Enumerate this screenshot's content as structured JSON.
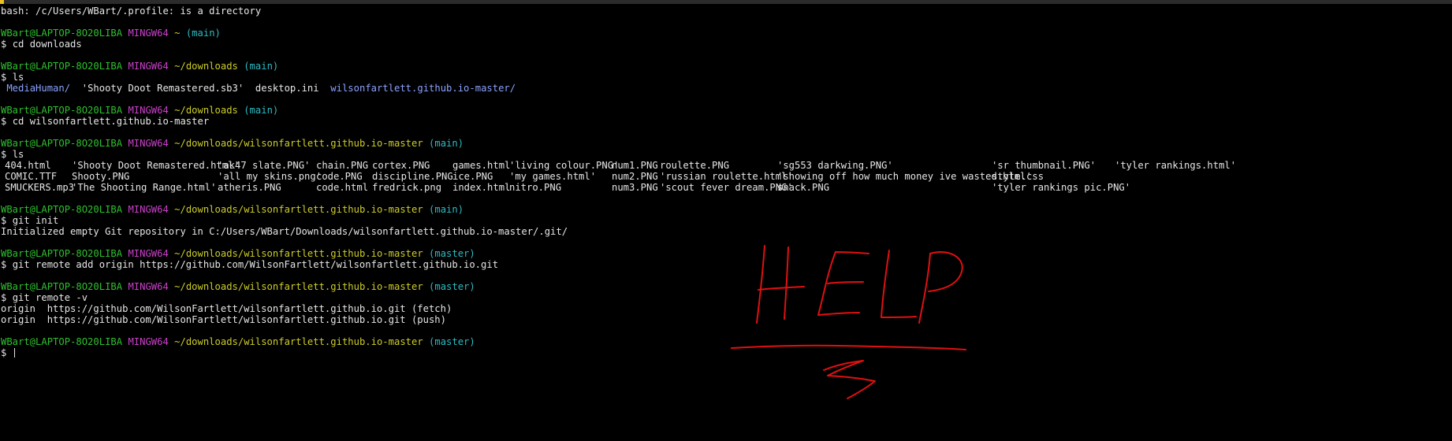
{
  "terminal": {
    "profile_error": "bash: /c/Users/WBart/.profile: is a directory",
    "prompt": {
      "user_host": "WBart@LAPTOP-8O20LIBA",
      "system": "MINGW64",
      "symbol": "$"
    },
    "blocks": [
      {
        "path": "~",
        "branch": "(main)",
        "command": "cd downloads",
        "output": []
      },
      {
        "path": "~/downloads",
        "branch": "(main)",
        "command": "ls"
      },
      {
        "path": "~/downloads",
        "branch": "(main)",
        "command": "cd wilsonfartlett.github.io-master",
        "output": []
      },
      {
        "path": "~/downloads/wilsonfartlett.github.io-master",
        "branch": "(main)",
        "command": "ls"
      },
      {
        "path": "~/downloads/wilsonfartlett.github.io-master",
        "branch": "(main)",
        "command": "git init",
        "output": [
          "Initialized empty Git repository in C:/Users/WBart/Downloads/wilsonfartlett.github.io-master/.git/"
        ]
      },
      {
        "path": "~/downloads/wilsonfartlett.github.io-master",
        "branch": "(master)",
        "command": "git remote add origin https://github.com/WilsonFartlett/wilsonfartlett.github.io.git",
        "output": []
      },
      {
        "path": "~/downloads/wilsonfartlett.github.io-master",
        "branch": "(master)",
        "command": "git remote -v",
        "output": [
          "origin  https://github.com/WilsonFartlett/wilsonfartlett.github.io.git (fetch)",
          "origin  https://github.com/WilsonFartlett/wilsonfartlett.github.io.git (push)"
        ]
      },
      {
        "path": "~/downloads/wilsonfartlett.github.io-master",
        "branch": "(master)",
        "command": "",
        "output": []
      }
    ],
    "ls_downloads": [
      {
        "name": "MediaHuman/",
        "dir": true
      },
      {
        "name": "'Shooty Doot Remastered.sb3'",
        "dir": false
      },
      {
        "name": "desktop.ini",
        "dir": false
      },
      {
        "name": "wilsonfartlett.github.io-master/",
        "dir": true
      }
    ],
    "ls_repo": [
      [
        "404.html",
        "'Shooty Doot Remastered.html'",
        "'ak47 slate.PNG'",
        "chain.PNG",
        "cortex.PNG",
        "games.html",
        "'living colour.PNG'",
        "num1.PNG",
        "roulette.PNG",
        "'sg553 darkwing.PNG'",
        "'sr thumbnail.PNG'",
        "'tyler rankings.html'"
      ],
      [
        "COMIC.TTF",
        "Shooty.PNG",
        "'all my skins.png'",
        "code.PNG",
        "discipline.PNG",
        "ice.PNG",
        "'my games.html'",
        "num2.PNG",
        "'russian roulette.html'",
        "'showing off how much money ive wasted.html'",
        "style.css",
        ""
      ],
      [
        "SMUCKERS.mp3",
        "'The Shooting Range.html'",
        "atheris.PNG",
        "code.html",
        "fredrick.png",
        "index.html",
        "nitro.PNG",
        "num3.PNG",
        "'scout fever dream.PNG'",
        "snack.PNG",
        "'tyler rankings pic.PNG'",
        ""
      ]
    ],
    "annotation_text": "HELP",
    "colors": {
      "background": "#000000",
      "text": "#e6e6e6",
      "user": "#2ec02e",
      "system": "#c940c9",
      "path": "#cdcd2a",
      "branch": "#2bbcc4",
      "directory": "#8aa2ff",
      "annotation": "#e01010"
    }
  }
}
